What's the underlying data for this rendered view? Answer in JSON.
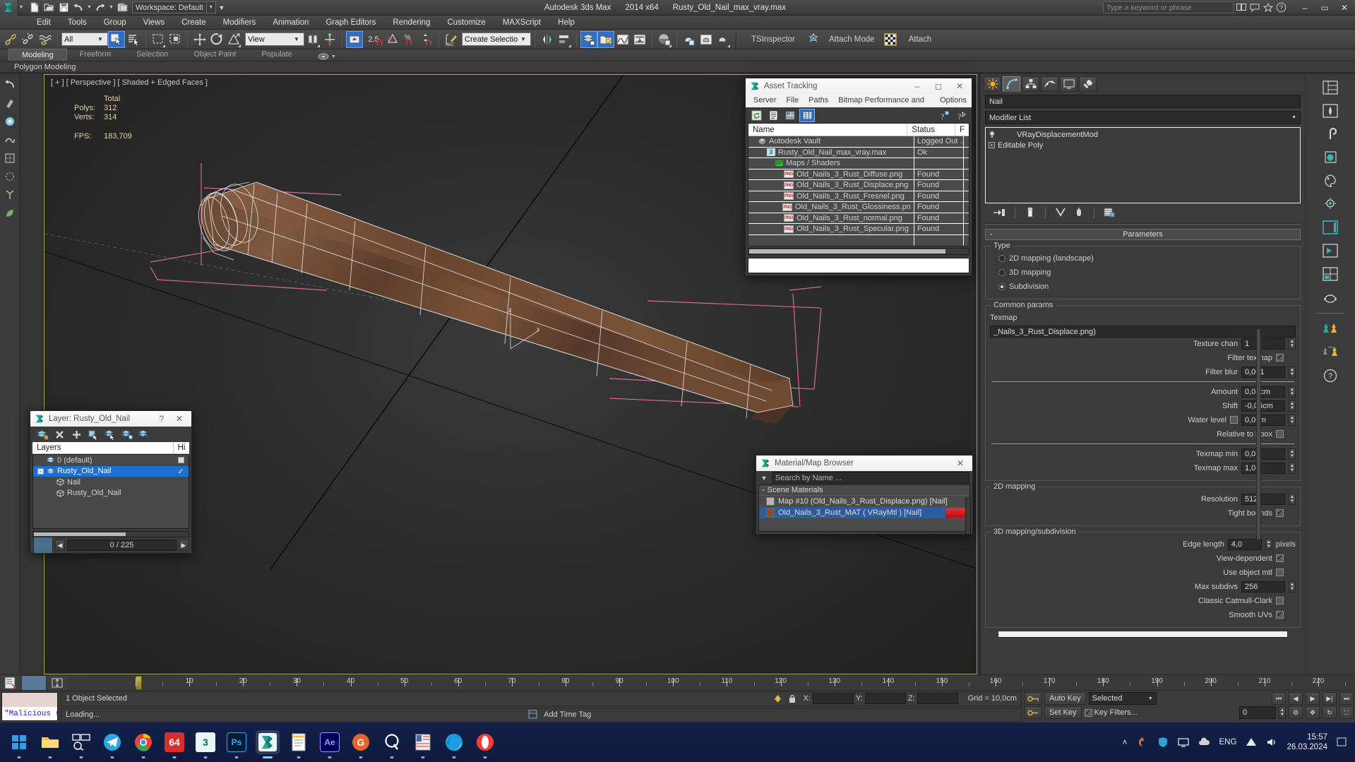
{
  "titlebar": {
    "app_name": "Autodesk 3ds Max",
    "version": "2014 x64",
    "file_name": "Rusty_Old_Nail_max_vray.max",
    "workspace": "Workspace: Default",
    "search_placeholder": "Type a keyword or phrase",
    "quick_access": [
      "new-file-icon",
      "open-file-icon",
      "save-file-icon",
      "undo-icon",
      "undo-dropdown-icon",
      "redo-icon",
      "redo-dropdown-icon",
      "set-project-folder-icon"
    ],
    "window_controls": {
      "minimize": "–",
      "maximize": "▭",
      "close": "✕"
    }
  },
  "menubar": {
    "items": [
      "Edit",
      "Tools",
      "Group",
      "Views",
      "Create",
      "Modifiers",
      "Animation",
      "Graph Editors",
      "Rendering",
      "Customize",
      "MAXScript",
      "Help"
    ]
  },
  "toolbar": {
    "selection_filter": "All",
    "reference_coord": "View",
    "named_selection_set": "Create Selection Se",
    "percent_snap": "2.5",
    "tsinspector_label": "TSInspector",
    "attach_mode_label": "Attach Mode",
    "attach_label": "Attach",
    "icons": [
      "select-and-link-icon",
      "unlink-selection-icon",
      "bind-to-spacewarp-icon",
      "select-object-icon",
      "select-by-name-icon",
      "rectangular-selection-region-icon",
      "window-crossing-icon",
      "select-and-move-icon",
      "select-and-rotate-icon",
      "select-and-scale-icon",
      "use-pivot-point-center-icon",
      "select-and-manipulate-icon",
      "snaps-toggle-icon",
      "angle-snap-toggle-icon",
      "percent-snap-toggle-icon",
      "spinner-snap-toggle-icon",
      "edit-named-selection-sets-icon",
      "mirror-icon",
      "align-icon",
      "layer-explorer-icon",
      "scene-explorer-icon",
      "curve-editor-icon",
      "schematic-view-icon",
      "material-editor-icon",
      "render-setup-icon",
      "rendered-frame-window-icon",
      "render-production-icon"
    ]
  },
  "ribbon": {
    "tabs": [
      "Modeling",
      "Freeform",
      "Selection",
      "Object Paint",
      "Populate"
    ],
    "active_tab": "Modeling",
    "subtitle": "Polygon Modeling"
  },
  "viewport": {
    "label": "[ + ] [ Perspective ] [ Shaded + Edged Faces ]",
    "stats": {
      "total_header": "Total",
      "rows": [
        {
          "label": "Polys:",
          "value": "312"
        },
        {
          "label": "Verts:",
          "value": "314"
        }
      ],
      "fps_label": "FPS:",
      "fps_value": "183,709"
    }
  },
  "asset_tracking": {
    "title": "Asset Tracking",
    "menu": [
      "Server",
      "File",
      "Paths",
      "Bitmap Performance and Memory",
      "Options"
    ],
    "toolbar_icons": [
      "refresh-icon",
      "list-view-icon",
      "report-view-icon",
      "grid-view-icon",
      "help-add-icon",
      "help-icon"
    ],
    "columns": [
      "Name",
      "Status",
      "F"
    ],
    "rows": [
      {
        "indent": 0,
        "icon": "vault-icon",
        "name": "Autodesk Vault",
        "status": "Logged Out ..."
      },
      {
        "indent": 1,
        "icon": "max-file-icon",
        "name": "Rusty_Old_Nail_max_vray.max",
        "status": "Ok"
      },
      {
        "indent": 2,
        "icon": "maps-icon",
        "name": "Maps / Shaders",
        "status": ""
      },
      {
        "indent": 3,
        "icon": "png-icon",
        "name": "Old_Nails_3_Rust_Diffuse.png",
        "status": "Found"
      },
      {
        "indent": 3,
        "icon": "png-icon",
        "name": "Old_Nails_3_Rust_Displace.png",
        "status": "Found"
      },
      {
        "indent": 3,
        "icon": "png-icon",
        "name": "Old_Nails_3_Rust_Fresnel.png",
        "status": "Found"
      },
      {
        "indent": 3,
        "icon": "png-icon",
        "name": "Old_Nails_3_Rust_Glossiness.png",
        "status": "Found"
      },
      {
        "indent": 3,
        "icon": "png-icon",
        "name": "Old_Nails_3_Rust_normal.png",
        "status": "Found"
      },
      {
        "indent": 3,
        "icon": "png-icon",
        "name": "Old_Nails_3_Rust_Specular.png",
        "status": "Found"
      }
    ]
  },
  "layer_dialog": {
    "title": "Layer: Rusty_Old_Nail",
    "help_glyph": "?",
    "toolbar_icons": [
      "create-new-layer-icon",
      "delete-layer-icon",
      "add-selection-icon",
      "select-objects-icon",
      "select-highlighted-icon",
      "highlight-selected-icon",
      "hide-unhide-icon"
    ],
    "columns": [
      "Layers",
      "Hi"
    ],
    "rows": [
      {
        "indent": 0,
        "icon": "layer-icon",
        "name": "0 (default)",
        "selected": false,
        "hide_box": "empty"
      },
      {
        "indent": 0,
        "icon": "layer-icon",
        "name": "Rusty_Old_Nail",
        "selected": true,
        "hide_box": "check",
        "expander": "-"
      },
      {
        "indent": 1,
        "icon": "object-icon",
        "name": "Nail",
        "selected": false,
        "hide_box": ""
      },
      {
        "indent": 1,
        "icon": "object-icon",
        "name": "Rusty_Old_Nail",
        "selected": false,
        "hide_box": ""
      }
    ],
    "footer": {
      "counter": "0 / 225",
      "prev": "◀",
      "next": "▶"
    }
  },
  "material_browser": {
    "title": "Material/Map Browser",
    "search_placeholder": "Search by Name ...",
    "group_label": "Scene Materials",
    "group_toggle": "-",
    "rows": [
      {
        "name": "Map #10 (Old_Nails_3_Rust_Displace.png) [Nail]",
        "swatch": "#b8b4ad",
        "selected": false
      },
      {
        "name": "Old_Nails_3_Rust_MAT  ( VRayMtl )  [Nail]",
        "swatch": "#8a4e2a",
        "selected": true
      }
    ]
  },
  "command_panel": {
    "tabs": [
      "create-tab-icon",
      "modify-tab-icon",
      "hierarchy-tab-icon",
      "motion-tab-icon",
      "display-tab-icon",
      "utilities-tab-icon"
    ],
    "active_tab_index": 1,
    "object_name": "Nail",
    "modifier_list_label": "Modifier List",
    "modifier_stack": [
      {
        "name": "VRayDisplacementMod",
        "has_toggle": true,
        "indent": true
      },
      {
        "name": "Editable Poly",
        "has_expander": true,
        "indent": false
      }
    ],
    "stack_buttons": [
      "pin-stack-icon",
      "show-end-result-icon",
      "make-unique-icon",
      "remove-modifier-icon",
      "configure-modifier-sets-icon"
    ],
    "rollout_title": "Parameters",
    "rollout_toggle": "-",
    "type_group": {
      "label": "Type",
      "options": [
        {
          "label": "2D mapping (landscape)",
          "selected": false
        },
        {
          "label": "3D mapping",
          "selected": false
        },
        {
          "label": "Subdivision",
          "selected": true
        }
      ]
    },
    "common_params": {
      "label": "Common params",
      "texmap_label": "Texmap",
      "texmap_value": "_Nails_3_Rust_Displace.png)",
      "fields": [
        {
          "label": "Texture chan",
          "value": "1",
          "type": "spinner"
        },
        {
          "label": "Filter texmap",
          "value": "",
          "type": "check",
          "checked": true
        },
        {
          "label": "Filter blur",
          "value": "0,001",
          "type": "spinner"
        },
        {
          "label": "Amount",
          "value": "0,07cm",
          "type": "spinner"
        },
        {
          "label": "Shift",
          "value": "-0,04cm",
          "type": "spinner"
        },
        {
          "label": "Water level",
          "value": "0,0cm",
          "type": "spinner-check",
          "checked": false
        },
        {
          "label": "Relative to bbox",
          "value": "",
          "type": "check",
          "checked": false
        },
        {
          "label": "Texmap min",
          "value": "0,0",
          "type": "spinner"
        },
        {
          "label": "Texmap max",
          "value": "1,0",
          "type": "spinner"
        }
      ]
    },
    "mapping_2d": {
      "label": "2D mapping",
      "fields": [
        {
          "label": "Resolution",
          "value": "512",
          "type": "spinner"
        },
        {
          "label": "Tight bounds",
          "value": "",
          "type": "check",
          "checked": true
        }
      ]
    },
    "mapping_3d": {
      "label": "3D mapping/subdivision",
      "fields": [
        {
          "label": "Edge length",
          "value": "4,0",
          "type": "spinner",
          "suffix": "pixels"
        },
        {
          "label": "View-dependent",
          "value": "",
          "type": "check",
          "checked": true
        },
        {
          "label": "Use object mtl",
          "value": "",
          "type": "check",
          "checked": false
        },
        {
          "label": "Max subdivs",
          "value": "256",
          "type": "spinner"
        },
        {
          "label": "Classic Catmull-Clark",
          "value": "",
          "type": "check",
          "checked": false
        },
        {
          "label": "Smooth UVs",
          "value": "",
          "type": "check",
          "checked": true
        }
      ]
    }
  },
  "timeline": {
    "ticks": [
      "10",
      "20",
      "30",
      "40",
      "50",
      "60",
      "70",
      "80",
      "90",
      "100",
      "110",
      "120",
      "130",
      "140",
      "150",
      "160",
      "170",
      "180",
      "190",
      "200",
      "210",
      "220"
    ],
    "current_frame": 0
  },
  "statusbar": {
    "maxscript_listener": "\"Malicious s",
    "selection_info": "1 Object Selected",
    "prompt": "Loading...",
    "coords": {
      "x_label": "X:",
      "y_label": "Y:",
      "z_label": "Z:",
      "x": "",
      "y": "",
      "z": ""
    },
    "grid": "Grid = 10,0cm",
    "add_time_tag": "Add Time Tag",
    "auto_key": "Auto Key",
    "set_key": "Set Key",
    "selected_dropdown": "Selected",
    "key_filters": "Key Filters...",
    "frame_field": "0"
  },
  "taskbar": {
    "items": [
      {
        "name": "start-button-icon",
        "glyph": "⊞",
        "color": "#2f9fe8",
        "active": false
      },
      {
        "name": "file-explorer-icon",
        "glyph": "🗀",
        "color": "#ffc44d",
        "active": false
      },
      {
        "name": "search-widget-icon",
        "glyph": "▣",
        "color": "#ffffff",
        "active": false
      },
      {
        "name": "telegram-icon",
        "glyph": "➤",
        "color": "#2ca5e0",
        "active": false
      },
      {
        "name": "chrome-icon",
        "glyph": "◉",
        "color": "#ea4335",
        "active": false
      },
      {
        "name": "app-64-icon",
        "glyph": "64",
        "color": "#d32f2f",
        "active": false
      },
      {
        "name": "3ds-max-icon-taskbar",
        "glyph": "3",
        "color": "#1fb8bd",
        "active": false
      },
      {
        "name": "photoshop-icon",
        "glyph": "Ps",
        "color": "#31a8ff",
        "active": false
      },
      {
        "name": "3ds-max-running-icon",
        "glyph": "❯",
        "color": "#1fb8bd",
        "active": true
      },
      {
        "name": "notepad-icon",
        "glyph": "≡",
        "color": "#f2e06a",
        "active": false
      },
      {
        "name": "after-effects-icon",
        "glyph": "Ae",
        "color": "#9999ff",
        "active": false
      },
      {
        "name": "guitar-pro-icon",
        "glyph": "G",
        "color": "#e8632a",
        "active": false
      },
      {
        "name": "substance-painter-icon",
        "glyph": "●",
        "color": "#ffffff",
        "active": false
      },
      {
        "name": "save-app-icon",
        "glyph": "▤",
        "color": "#e8e8e8",
        "active": false
      },
      {
        "name": "edge-icon",
        "glyph": "◐",
        "color": "#36a9e0",
        "active": false
      },
      {
        "name": "opera-icon",
        "glyph": "O",
        "color": "#ff3b3b",
        "active": false
      }
    ],
    "tray": {
      "chevron": "˄",
      "icons": [
        "flame-icon",
        "antivirus-icon",
        "display-icon",
        "cloud-icon",
        "network-icon",
        "bluetooth-icon"
      ],
      "language": "ENG",
      "wifi": "◠",
      "volume": "🔊",
      "time": "15:57",
      "date": "26.03.2024"
    }
  }
}
